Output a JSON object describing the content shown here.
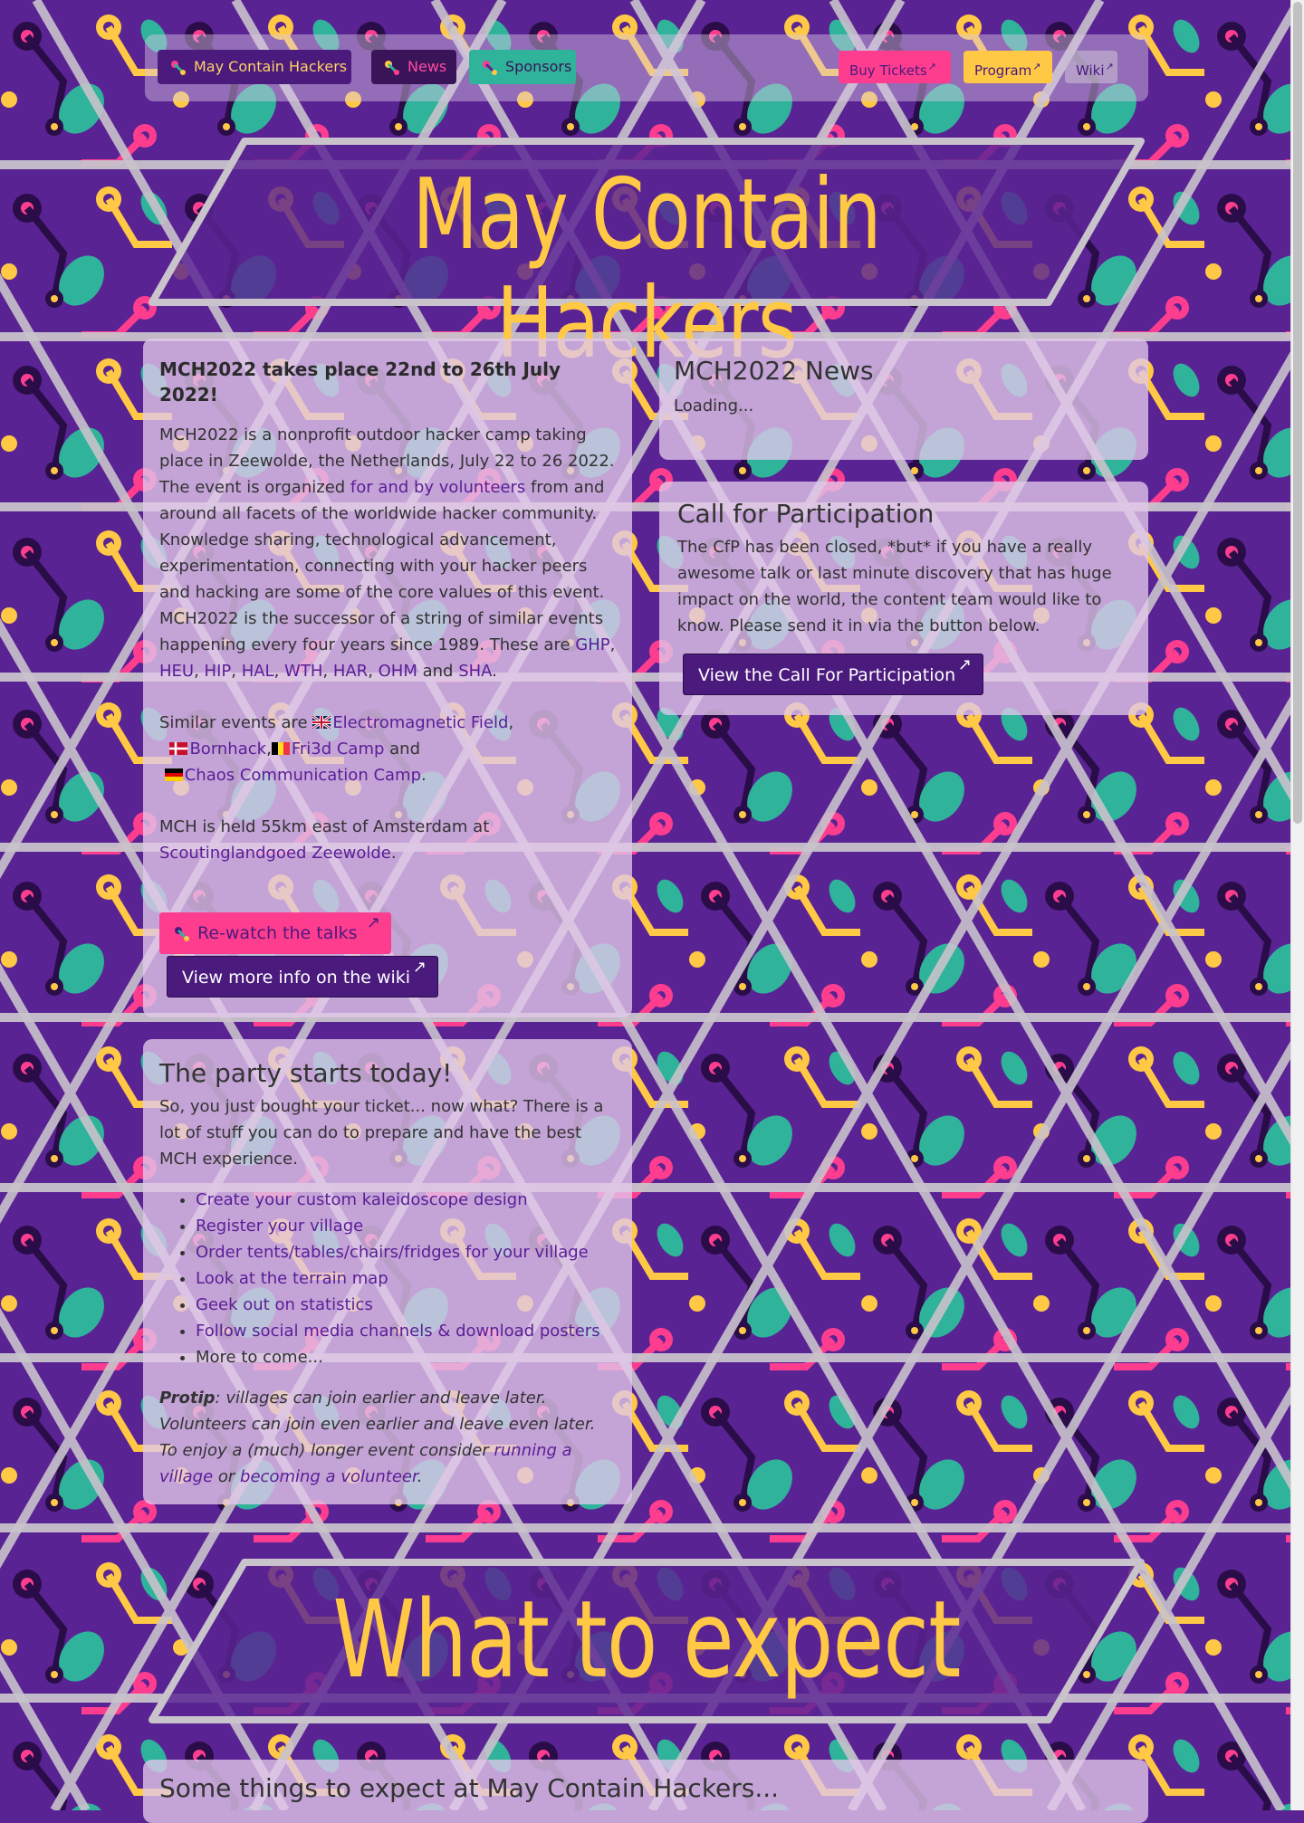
{
  "nav": {
    "home": "May Contain Hackers",
    "news": "News",
    "sponsors": "Sponsors",
    "tickets": "Buy Tickets",
    "program": "Program",
    "wiki": "Wiki",
    "external_mark": "↗"
  },
  "banner_top": "May Contain Hackers",
  "intro": {
    "title": "MCH2022 takes place 22nd to 26th July 2022!",
    "p1_a": "MCH2022 is a nonprofit outdoor hacker camp taking place in Zeewolde, the Netherlands, July 22 to 26 2022. The event is organized ",
    "p1_link": "for and by volunteers",
    "p1_b": " from and around all facets of the worldwide hacker community.",
    "p2": "Knowledge sharing, technological advancement, experimentation, connecting with your hacker peers and hacking are some of the core values of this event.",
    "p3_a": "MCH2022 is the successor of a string of similar events happening every four years since 1989. These are ",
    "p3_links": [
      "GHP",
      "HEU",
      "HIP",
      "HAL",
      "WTH",
      "HAR",
      "OHM",
      "SHA"
    ],
    "p3_and": " and ",
    "p4_a": "Similar events are ",
    "emf": "Electromagnetic Field",
    "bornhack": "Bornhack",
    "fri3d": "Fri3d Camp",
    "and": " and",
    "ccc": "Chaos Communication Camp",
    "p5_a": "MCH is held 55km east of Amsterdam at ",
    "p5_link": "Scoutinglandgoed Zeewolde",
    "rewatch": "Re-watch the talks",
    "wiki_btn": "View more info on the wiki"
  },
  "news": {
    "title": "MCH2022 News",
    "loading": "Loading..."
  },
  "cfp": {
    "title": "Call for Participation",
    "text": "The CfP has been closed, *but* if you have a really awesome talk or last minute discovery that has huge impact on the world, the content team would like to know. Please send it in via the button below.",
    "button": "View the Call For Participation"
  },
  "party": {
    "title": "The party starts today!",
    "intro": "So, you just bought your ticket... now what? There is a lot of stuff you can do to prepare and have the best MCH experience.",
    "items": [
      "Create your custom kaleidoscope design",
      "Register your village",
      "Order tents/tables/chairs/fridges for your village",
      "Look at the terrain map",
      "Geek out on statistics",
      "Follow social media channels & download posters",
      "More to come..."
    ],
    "protip_label": "Protip",
    "protip_text": ": villages can join earlier and leave later. Volunteers can join even earlier and leave even later. To enjoy a (much) longer event consider ",
    "protip_link1": "running a village",
    "protip_or": " or ",
    "protip_link2": "becoming a volunteer",
    "protip_end": "."
  },
  "banner_expect": "What to expect",
  "some_things": "Some things to expect at May Contain Hackers...",
  "colors": {
    "purple": "#5a2393",
    "pink": "#ff3d8f",
    "yellow": "#ffc845",
    "teal": "#2fb39a",
    "dark": "#2a0d48"
  },
  "icons": {
    "nav_home": "hacker-logo-icon",
    "nav_news": "hacker-logo-icon",
    "nav_sponsors": "hacker-logo-icon",
    "rewatch": "hacker-logo-icon",
    "flag_uk": "uk-flag-icon",
    "flag_dk": "denmark-flag-icon",
    "flag_be": "belgium-flag-icon",
    "flag_de": "germany-flag-icon"
  }
}
